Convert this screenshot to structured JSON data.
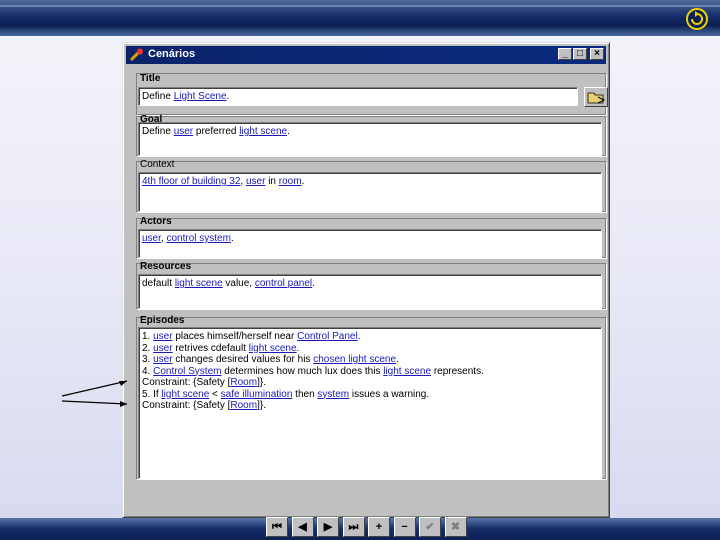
{
  "colors": {
    "window_title_bg": "#0a246a",
    "link": "#1a1ab8",
    "banner": "#152c66"
  },
  "window": {
    "title": "Cenários",
    "icon": "wrench-icon",
    "controls": {
      "minimize": "_",
      "maximize": "□",
      "close": "×"
    }
  },
  "fields": {
    "title": {
      "label": "Title",
      "value": "Define Light Scene."
    },
    "goal": {
      "label": "Goal",
      "value": "Define user preferred light scene."
    },
    "context": {
      "label": "Context",
      "value": "4th floor of building 32, user in room."
    },
    "actors": {
      "label": "Actors",
      "value": "user, control system."
    },
    "resources": {
      "label": "Resources",
      "value": "default light scene value, control panel."
    },
    "episodes": {
      "label": "Episodes",
      "lines": [
        "1. user places himself/herself near Control Panel.",
        "2. user retrives cdefault light scene.",
        "3. user changes desired values for his chosen light scene.",
        "4. Control System determines how much lux does this light scene represents.",
        "Constraint: {Safety [Room]}.",
        "5. If light scene < safe illumination then system issues a warning.",
        "Constraint: {Safety [Room]}."
      ]
    }
  },
  "links": {
    "title": [
      "Light Scene"
    ],
    "goal": [
      "user",
      "light scene"
    ],
    "context": [
      "4th floor of building 32",
      "user",
      "room"
    ],
    "actors": [
      "user",
      "control system"
    ],
    "resources": [
      "light scene",
      "control panel"
    ]
  },
  "nav_buttons": [
    {
      "name": "first-record-button",
      "glyph": "⏮",
      "enabled": true
    },
    {
      "name": "prev-record-button",
      "glyph": "◀",
      "enabled": true
    },
    {
      "name": "next-record-button",
      "glyph": "▶",
      "enabled": true
    },
    {
      "name": "last-record-button",
      "glyph": "⏭",
      "enabled": true
    },
    {
      "name": "add-record-button",
      "glyph": "+",
      "enabled": true
    },
    {
      "name": "delete-record-button",
      "glyph": "−",
      "enabled": true
    },
    {
      "name": "confirm-button",
      "glyph": "✔",
      "enabled": false
    },
    {
      "name": "cancel-edit-button",
      "glyph": "✖",
      "enabled": false
    }
  ],
  "icons": {
    "corner": "refresh-icon",
    "pick": "open-folder-icon"
  }
}
